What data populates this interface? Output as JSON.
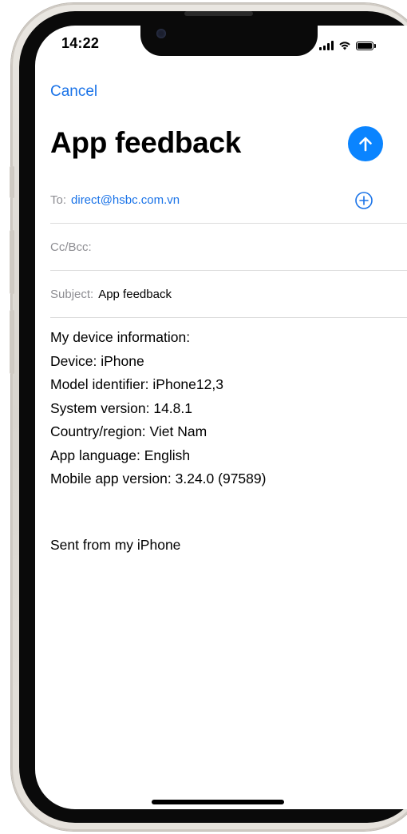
{
  "status_bar": {
    "time": "14:22"
  },
  "compose": {
    "cancel_label": "Cancel",
    "title": "App feedback",
    "to_label": "To:",
    "to_value": "direct@hsbc.com.vn",
    "cc_label": "Cc/Bcc:",
    "subject_label": "Subject:",
    "subject_value": "App feedback",
    "body": [
      "My device information:",
      "Device: iPhone",
      "Model identifier: iPhone12,3",
      "System version: 14.8.1",
      "Country/region: Viet Nam",
      "App language: English",
      "Mobile app version: 3.24.0 (97589)"
    ],
    "signature": "Sent from my iPhone"
  },
  "icons": {
    "send": "arrow-up-icon",
    "add_recipient": "plus-circle-icon",
    "signal": "cellular-signal-icon",
    "wifi": "wifi-icon",
    "battery": "battery-icon"
  },
  "colors": {
    "link": "#1a73e8",
    "send_button": "#0a84ff",
    "field_label": "#8e8e93",
    "divider": "#dcdcdc"
  }
}
